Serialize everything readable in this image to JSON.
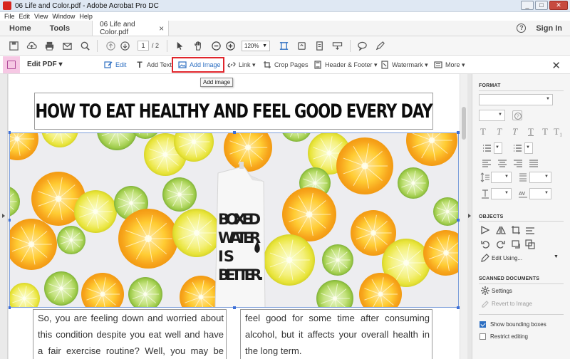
{
  "window": {
    "title": "06 Life and Color.pdf - Adobe Acrobat Pro DC",
    "controls": [
      "_",
      "□",
      "✕"
    ]
  },
  "menu": [
    "File",
    "Edit",
    "View",
    "Window",
    "Help"
  ],
  "tabs": {
    "home": "Home",
    "tools": "Tools",
    "document": "06 Life and Color.pdf",
    "document_close": "×",
    "sign_in": "Sign In",
    "help": "?"
  },
  "toolbar": {
    "page_current": "1",
    "page_total": "/ 2",
    "zoom": "120%"
  },
  "editbar": {
    "title": "Edit PDF",
    "items": {
      "edit": "Edit",
      "add_text": "Add Text",
      "add_image": "Add Image",
      "link": "Link",
      "crop_pages": "Crop Pages",
      "header_footer": "Header & Footer",
      "watermark": "Watermark",
      "more": "More"
    },
    "close": "✕",
    "tooltip": "Add image"
  },
  "document": {
    "headline": "HOW TO EAT HEALTHY AND FEEL GOOD EVERY DAY",
    "carton_text": [
      "BOXED",
      "WATER",
      "IS",
      "BETTER."
    ],
    "col1": "So, you are feeling down and worried about this condition despite you eat well and have a fair exercise routine? Well, you may be eating",
    "col2": "feel good for some time after consuming alcohol, but it affects your overall health in the long term."
  },
  "panel": {
    "format_header": "FORMAT",
    "text_styles": [
      "T",
      "T",
      "T",
      "T",
      "T",
      "T₁"
    ],
    "objects_header": "OBJECTS",
    "edit_using": "Edit Using...",
    "scanned_header": "SCANNED DOCUMENTS",
    "settings": "Settings",
    "revert": "Revert to Image",
    "show_bboxes": "Show bounding boxes",
    "show_bboxes_checked": true,
    "restrict": "Restrict editing",
    "restrict_checked": false,
    "tracking_label": "AV"
  },
  "colors": {
    "accent_blue": "#2d6fc2",
    "highlight_red": "#e0252b",
    "edit_pink": "#f6c8e4"
  }
}
